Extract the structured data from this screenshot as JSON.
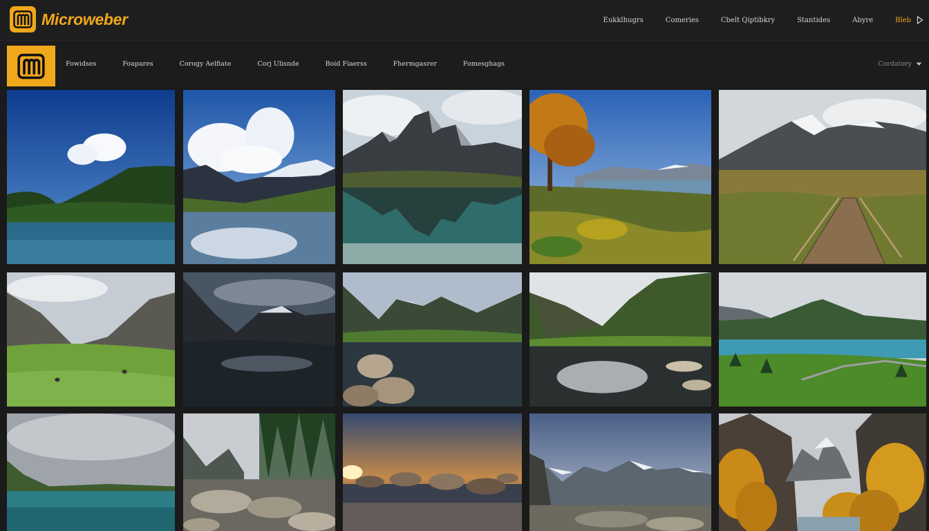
{
  "brand": {
    "name": "Microweber"
  },
  "header": {
    "nav": [
      "Eukklhugrs",
      "Comeries",
      "Cbelt Qiptibkry",
      "Stantides",
      "Abyre"
    ],
    "accent_item": "Bleb"
  },
  "catbar": {
    "items": [
      "Fowidses",
      "Foapares",
      "Corogy Aelfiate",
      "Corj Ulisnde",
      "Boid Fiaerss",
      "Fhermgasrer",
      "Fomesghags"
    ],
    "select_label": "Cordatory"
  },
  "colors": {
    "accent": "#f0a71c",
    "background": "#1a1a1a"
  },
  "icons": {
    "logo": "microweber-logo-icon",
    "arrow": "play-arrow-icon",
    "dropdown": "chevron-down-icon"
  },
  "gallery": {
    "photos": [
      "lake-green-hills-blue-sky",
      "snowy-peaks-cloud-reflection",
      "rocky-peak-teal-lake-reflection",
      "autumn-tree-meadow-lake",
      "wooden-boardwalk-snowy-mountain",
      "green-valley-grazing",
      "dark-mountain-lake-reflection",
      "boulders-mountain-lake",
      "green-cliffs-lake-rocks",
      "turquoise-lake-forest-mountain",
      "cloudy-turquoise-shore",
      "pine-forest-rocks-stream",
      "sunset-rocks-water",
      "snowy-range-rocky-foreground",
      "golden-larches-canyon"
    ]
  }
}
